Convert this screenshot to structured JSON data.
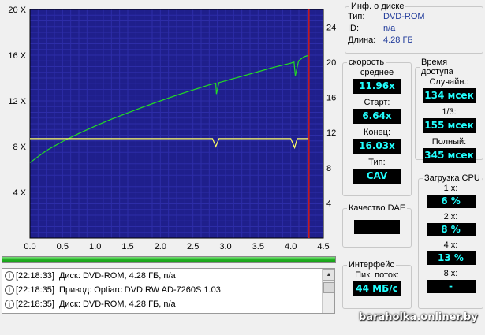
{
  "chart_data": {
    "type": "line",
    "x_ticks": [
      "0.0",
      "0.5",
      "1.0",
      "1.5",
      "2.0",
      "2.5",
      "3.0",
      "3.5",
      "4.0",
      "4.5"
    ],
    "xlim": [
      0,
      4.5
    ],
    "y_left_ticks": [
      "20 X",
      "16 X",
      "12 X",
      "8 X",
      "4 X"
    ],
    "ylim_left": [
      0,
      20
    ],
    "y_right_ticks": [
      "24",
      "20",
      "16",
      "12",
      "8",
      "4"
    ],
    "ylim_right": [
      0,
      26
    ],
    "marker_x": 4.28,
    "grid": true,
    "series": [
      {
        "color": "#22dd22",
        "x": [
          0.0,
          0.25,
          0.5,
          0.75,
          1.0,
          1.25,
          1.5,
          1.75,
          2.0,
          2.25,
          2.5,
          2.75,
          2.85,
          2.86,
          2.9,
          3.0,
          3.25,
          3.5,
          3.75,
          4.0,
          4.05,
          4.07,
          4.12,
          4.2,
          4.28
        ],
        "y": [
          6.6,
          7.65,
          8.45,
          9.15,
          9.8,
          10.4,
          10.95,
          11.5,
          12.0,
          12.5,
          12.95,
          13.4,
          13.55,
          12.6,
          13.6,
          13.75,
          14.15,
          14.55,
          14.95,
          15.3,
          15.4,
          14.2,
          15.5,
          15.85,
          16.0
        ]
      },
      {
        "color": "#ffff66",
        "x": [
          0.0,
          0.5,
          1.0,
          1.5,
          2.0,
          2.5,
          2.8,
          2.85,
          2.9,
          3.0,
          3.5,
          4.0,
          4.06,
          4.1,
          4.2,
          4.28
        ],
        "y": [
          8.7,
          8.7,
          8.7,
          8.7,
          8.7,
          8.7,
          8.7,
          8.0,
          8.7,
          8.7,
          8.7,
          8.7,
          7.9,
          8.7,
          8.7,
          8.7
        ]
      }
    ]
  },
  "progress": {
    "value": 1.0
  },
  "log": [
    {
      "time": "[22:18:33]",
      "text": "Диск: DVD-ROM, 4.28 ГБ, n/a"
    },
    {
      "time": "[22:18:35]",
      "text": "Привод: Optiarc DVD RW AD-7260S  1.03"
    },
    {
      "time": "[22:18:35]",
      "text": "Диск: DVD-ROM, 4.28 ГБ, n/a"
    }
  ],
  "disc_info": {
    "title": "Инф. о диске",
    "rows": [
      {
        "label": "Тип:",
        "value": "DVD-ROM"
      },
      {
        "label": "ID:",
        "value": "n/a"
      },
      {
        "label": "Длина:",
        "value": "4.28 ГБ"
      }
    ]
  },
  "speed": {
    "title": "скорость",
    "avg_label": "среднее",
    "avg": "11.96x",
    "start_label": "Старт:",
    "start": "6.64x",
    "end_label": "Конец:",
    "end": "16.03x",
    "type_label": "Тип:",
    "type": "CAV"
  },
  "access": {
    "title": "Время доступа",
    "random_label": "Случайн.:",
    "random": "134 мсек",
    "third_label": "1/3:",
    "third": "155 мсек",
    "full_label": "Полный:",
    "full": "345 мсек"
  },
  "dae": {
    "title": "Качество DAE"
  },
  "cpu": {
    "title": "Загрузка CPU",
    "x1_label": "1 x:",
    "x1": "6 %",
    "x2_label": "2 x:",
    "x2": "8 %",
    "x4_label": "4 x:",
    "x4": "13 %",
    "x8_label": "8 x:",
    "x8": "-"
  },
  "iface": {
    "title": "Интерфейс",
    "burst_label": "Пик. поток:",
    "burst": "44 МБ/с"
  },
  "watermark": "baraholka.onliner.by"
}
